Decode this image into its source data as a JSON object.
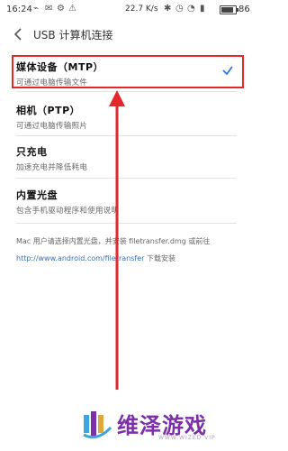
{
  "status_bar": {
    "time": "16:24",
    "net_speed": "22.7 K/s",
    "battery": "86",
    "battery_level_percent": 86
  },
  "header": {
    "title": "USB 计算机连接"
  },
  "options": [
    {
      "name": "媒体设备（MTP）",
      "desc": "可通过电脑传输文件",
      "selected": true
    },
    {
      "name": "相机（PTP）",
      "desc": "可通过电脑传输照片",
      "selected": false
    },
    {
      "name": "只充电",
      "desc": "加速充电并降低耗电",
      "selected": false
    },
    {
      "name": "内置光盘",
      "desc": "包含手机驱动程序和使用说明",
      "selected": false
    }
  ],
  "footnote": {
    "text_before": "Mac 用户请选择内置光盘，并安装 filetransfer.dmg 或前往 ",
    "link": "http://www.android.com/filetransfer",
    "text_after": " 下载安装"
  },
  "watermark": {
    "brand": "维泽游戏",
    "brand_en": "WWW.WIZED VIP"
  },
  "colors": {
    "highlight": "#e5262b",
    "check": "#2a7be0",
    "link": "#3b6fb5",
    "brand": "#7b2fa8"
  }
}
